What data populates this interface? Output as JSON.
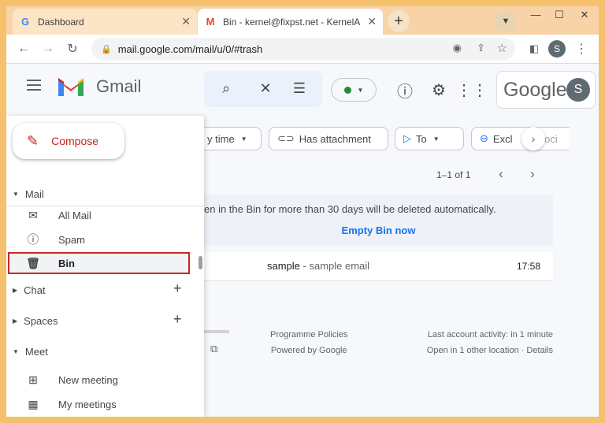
{
  "browser": {
    "tabs": [
      {
        "title": "Dashboard",
        "favicon": "G"
      },
      {
        "title": "Bin - kernel@fixpst.net - KernelA",
        "favicon": "M"
      }
    ],
    "url": "mail.google.com/mail/u/0/#trash",
    "profile_initial": "S"
  },
  "gmail": {
    "brand": "Gmail",
    "google_word": "Google",
    "account_initial": "S",
    "compose_label": "Compose",
    "sidebar": {
      "mail_section": "Mail",
      "mail_items": [
        {
          "label": "All Mail",
          "icon": "mail-icon"
        },
        {
          "label": "Spam",
          "icon": "spam-icon"
        },
        {
          "label": "Bin",
          "icon": "bin-icon",
          "selected": true
        }
      ],
      "chat_section": "Chat",
      "spaces_section": "Spaces",
      "meet_section": "Meet",
      "meet_items": [
        {
          "label": "New meeting",
          "icon": "new-meeting-icon"
        },
        {
          "label": "My meetings",
          "icon": "calendar-icon"
        }
      ]
    },
    "filters": {
      "time": "y time",
      "attachment": "Has attachment",
      "to": "To",
      "exclude": "Excl",
      "exclude_tail": "Soci"
    },
    "pager": "1–1 of 1",
    "bin_notice": "en in the Bin for more than 30 days will be deleted automatically.",
    "empty_bin": "Empty Bin now",
    "emails": [
      {
        "subject": "sample",
        "snippet": " - sample email",
        "time": "17:58"
      }
    ],
    "footer": {
      "policies": "Programme Policies",
      "powered": "Powered by Google",
      "activity": "Last account activity: in 1 minute",
      "location": "Open in 1 other location · Details"
    }
  }
}
